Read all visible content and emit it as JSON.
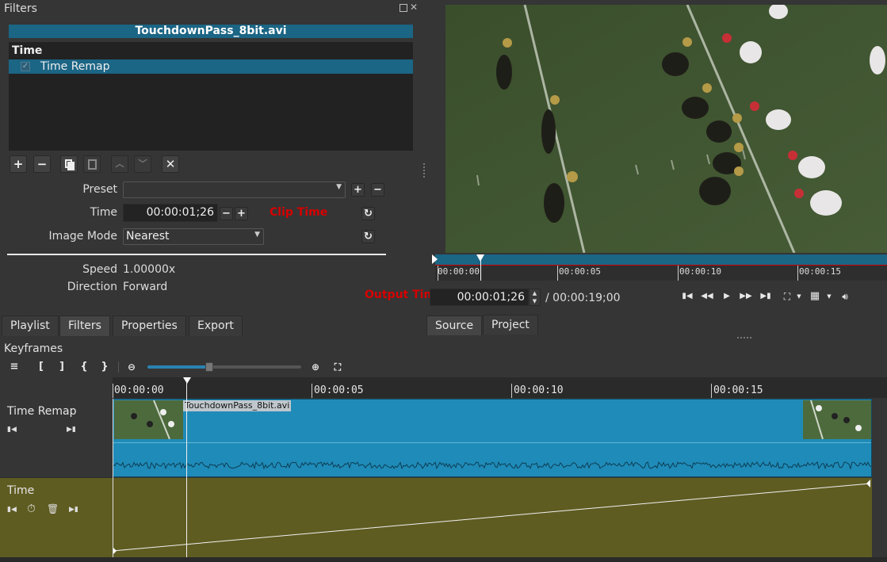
{
  "filters_panel": {
    "title": "Filters",
    "clip_name": "TouchdownPass_8bit.avi",
    "category": "Time",
    "filter_item": "Time Remap",
    "preset_label": "Preset",
    "time_label": "Time",
    "time_value": "00:00:01;26",
    "annotation_clip_time": "Clip Time",
    "image_mode_label": "Image Mode",
    "image_mode_value": "Nearest",
    "speed_label": "Speed",
    "speed_value": "1.00000x",
    "direction_label": "Direction",
    "direction_value": "Forward"
  },
  "left_tabs": [
    "Playlist",
    "Filters",
    "Properties",
    "Export"
  ],
  "player": {
    "ruler_ticks": [
      "00:00:00",
      "00:00:05",
      "00:00:10",
      "00:00:15"
    ],
    "annotation_output_time": "Output Time",
    "current_time": "00:00:01;26",
    "duration": "/ 00:00:19;00",
    "tabs": [
      "Source",
      "Project"
    ]
  },
  "keyframes": {
    "title": "Keyframes",
    "ruler_ticks": [
      "00:00:00",
      "00:00:05",
      "00:00:10",
      "00:00:15"
    ],
    "track1_name": "Time Remap",
    "track2_name": "Time",
    "clip_label": "TouchdownPass_8bit.avi"
  },
  "colors": {
    "selection": "#1b6585",
    "clip": "#1f8bb8",
    "keyframe_track": "#5f5c22",
    "annotation": "#d60000"
  }
}
